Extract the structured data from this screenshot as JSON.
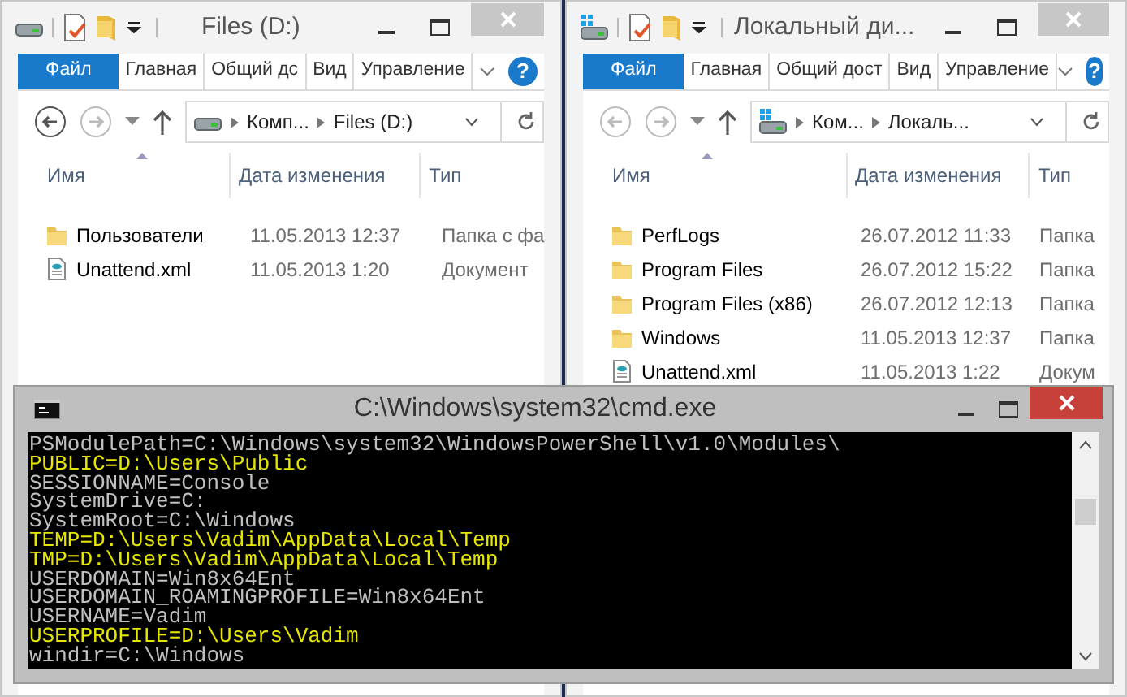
{
  "explorers": [
    {
      "title": "Files (D:)",
      "kind": "drive",
      "ribbon_tabs": [
        {
          "label": "Файл",
          "selected": true
        },
        {
          "label": "Главная",
          "selected": false
        },
        {
          "label": "Общий дс",
          "selected": false
        },
        {
          "label": "Вид",
          "selected": false
        },
        {
          "label": "Управление",
          "selected": false
        }
      ],
      "help": "?",
      "back_enabled": true,
      "breadcrumb": [
        "Комп...",
        "Files (D:)"
      ],
      "columns": [
        "Имя",
        "Дата изменения",
        "Тип"
      ],
      "files": [
        {
          "kind": "folder",
          "name": "Пользователи",
          "date": "11.05.2013 12:37",
          "type": "Папка с фа"
        },
        {
          "kind": "xml",
          "name": "Unattend.xml",
          "date": "11.05.2013 1:20",
          "type": "Документ"
        }
      ]
    },
    {
      "title": "Локальный ди...",
      "kind": "system-drive",
      "ribbon_tabs": [
        {
          "label": "Файл",
          "selected": true
        },
        {
          "label": "Главная",
          "selected": false
        },
        {
          "label": "Общий дост",
          "selected": false
        },
        {
          "label": "Вид",
          "selected": false
        },
        {
          "label": "Управление",
          "selected": false
        }
      ],
      "help": "?",
      "back_enabled": false,
      "breadcrumb": [
        "Ком...",
        "Локаль..."
      ],
      "columns": [
        "Имя",
        "Дата изменения",
        "Тип"
      ],
      "files": [
        {
          "kind": "folder",
          "name": "PerfLogs",
          "date": "26.07.2012 11:33",
          "type": "Папка"
        },
        {
          "kind": "folder",
          "name": "Program Files",
          "date": "26.07.2012 15:22",
          "type": "Папка"
        },
        {
          "kind": "folder",
          "name": "Program Files (x86)",
          "date": "26.07.2012 12:13",
          "type": "Папка"
        },
        {
          "kind": "folder",
          "name": "Windows",
          "date": "11.05.2013 12:37",
          "type": "Папка"
        },
        {
          "kind": "xml",
          "name": "Unattend.xml",
          "date": "11.05.2013 1:22",
          "type": "Докум"
        }
      ]
    }
  ],
  "console": {
    "title": "C:\\Windows\\system32\\cmd.exe",
    "lines": [
      {
        "text": "PSModulePath=C:\\Windows\\system32\\WindowsPowerShell\\v1.0\\Modules\\",
        "highlighted": false
      },
      {
        "text": "PUBLIC=D:\\Users\\Public",
        "highlighted": true
      },
      {
        "text": "SESSIONNAME=Console",
        "highlighted": false
      },
      {
        "text": "SystemDrive=C:",
        "highlighted": false
      },
      {
        "text": "SystemRoot=C:\\Windows",
        "highlighted": false
      },
      {
        "text": "TEMP=D:\\Users\\Vadim\\AppData\\Local\\Temp",
        "highlighted": true
      },
      {
        "text": "TMP=D:\\Users\\Vadim\\AppData\\Local\\Temp",
        "highlighted": true
      },
      {
        "text": "USERDOMAIN=Win8x64Ent",
        "highlighted": false
      },
      {
        "text": "USERDOMAIN_ROAMINGPROFILE=Win8x64Ent",
        "highlighted": false
      },
      {
        "text": "USERNAME=Vadim",
        "highlighted": false
      },
      {
        "text": "USERPROFILE=D:\\Users\\Vadim",
        "highlighted": true
      },
      {
        "text": "windir=C:\\Windows",
        "highlighted": false
      }
    ]
  }
}
